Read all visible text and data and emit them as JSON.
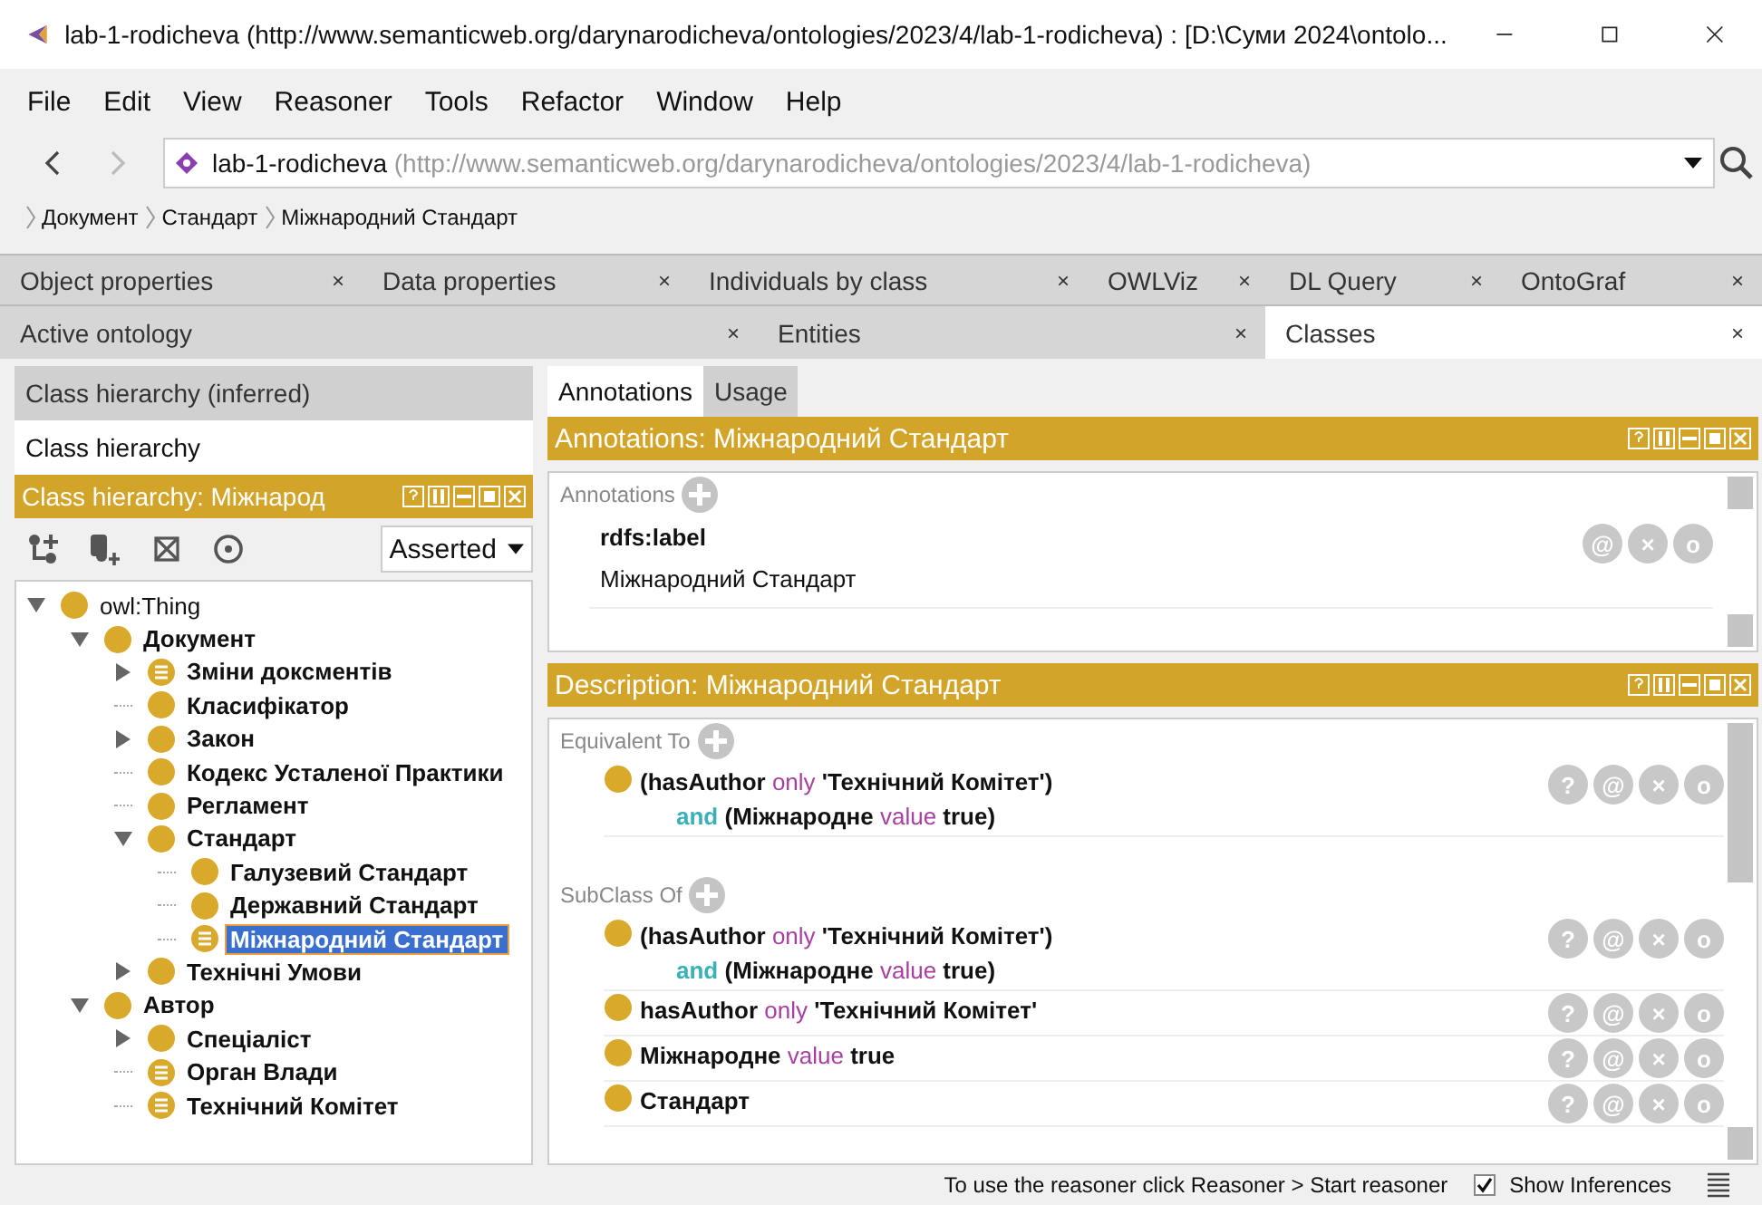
{
  "window": {
    "title": "lab-1-rodicheva (http://www.semanticweb.org/darynarodicheva/ontologies/2023/4/lab-1-rodicheva)  : [D:\\Суми 2024\\ontolo..."
  },
  "menu": [
    "File",
    "Edit",
    "View",
    "Reasoner",
    "Tools",
    "Refactor",
    "Window",
    "Help"
  ],
  "address": {
    "name": "lab-1-rodicheva",
    "iri": "(http://www.semanticweb.org/darynarodicheva/ontologies/2023/4/lab-1-rodicheva)"
  },
  "breadcrumb": [
    "Документ",
    "Стандарт",
    "Міжнародний Стандарт"
  ],
  "tabs_row_1": [
    {
      "label": "Object properties",
      "selected": false
    },
    {
      "label": "Data properties",
      "selected": false
    },
    {
      "label": "Individuals by class",
      "selected": false
    },
    {
      "label": "OWLViz",
      "selected": false
    },
    {
      "label": "DL Query",
      "selected": false
    },
    {
      "label": "OntoGraf",
      "selected": false
    }
  ],
  "tabs_row_2": [
    {
      "label": "Active ontology",
      "selected": false
    },
    {
      "label": "Entities",
      "selected": false
    },
    {
      "label": "Classes",
      "selected": true
    }
  ],
  "close_mark": "×",
  "left": {
    "view_tabs": [
      {
        "label": "Class hierarchy (inferred)",
        "selected": false
      },
      {
        "label": "Class hierarchy",
        "selected": true
      }
    ],
    "header": "Class hierarchy: Міжнарод",
    "mode": "Asserted",
    "tree": [
      {
        "label": "owl:Thing",
        "kind": "primitive",
        "expanded": true,
        "selected": false,
        "children": [
          {
            "label": "Документ",
            "kind": "primitive",
            "expanded": true,
            "selected": false,
            "children": [
              {
                "label": "Зміни доксментів",
                "kind": "defined",
                "expanded": false,
                "selected": false
              },
              {
                "label": "Класифікатор",
                "kind": "primitive",
                "selected": false
              },
              {
                "label": "Закон",
                "kind": "primitive",
                "expanded": false,
                "selected": false
              },
              {
                "label": "Кодекс Усталеної Практики",
                "kind": "primitive",
                "selected": false
              },
              {
                "label": "Регламент",
                "kind": "primitive",
                "selected": false
              },
              {
                "label": "Стандарт",
                "kind": "primitive",
                "expanded": true,
                "selected": false,
                "children": [
                  {
                    "label": "Галузевий Стандарт",
                    "kind": "primitive",
                    "selected": false
                  },
                  {
                    "label": "Державний Стандарт",
                    "kind": "primitive",
                    "selected": false
                  },
                  {
                    "label": "Міжнародний Стандарт",
                    "kind": "defined",
                    "selected": true
                  }
                ]
              },
              {
                "label": "Технічні Умови",
                "kind": "primitive",
                "expanded": false,
                "selected": false
              }
            ]
          },
          {
            "label": "Автор",
            "kind": "primitive",
            "expanded": true,
            "selected": false,
            "children": [
              {
                "label": "Спеціаліст",
                "kind": "primitive",
                "expanded": false,
                "selected": false
              },
              {
                "label": "Орган Влади",
                "kind": "defined",
                "selected": false
              },
              {
                "label": "Технічний Комітет",
                "kind": "defined",
                "selected": false
              }
            ]
          }
        ]
      }
    ]
  },
  "right": {
    "view_tabs": [
      {
        "label": "Annotations",
        "selected": true
      },
      {
        "label": "Usage",
        "selected": false
      }
    ],
    "annotations_header": "Annotations: Міжнародний Стандарт",
    "annotations": {
      "title": "Annotations",
      "items": [
        {
          "property": "rdfs:label",
          "value": "Міжнародний Стандарт",
          "buttons": [
            "@",
            "×",
            "o"
          ]
        }
      ]
    },
    "description_header": "Description: Міжнародний Стандарт",
    "sections": [
      {
        "title": "Equivalent To",
        "items": [
          {
            "buttons": [
              "?",
              "@",
              "×",
              "o"
            ],
            "lines": [
              [
                {
                  "t": "(hasAuthor ",
                  "kind": "name"
                },
                {
                  "t": "only",
                  "kind": "keyword"
                },
                {
                  "t": " 'Технічний Комітет')",
                  "kind": "name"
                }
              ],
              [
                {
                  "t": "and",
                  "kind": "connective"
                },
                {
                  "t": " (Міжнародне ",
                  "kind": "name"
                },
                {
                  "t": "value",
                  "kind": "keyword"
                },
                {
                  "t": " true)",
                  "kind": "name"
                }
              ]
            ]
          }
        ]
      },
      {
        "title": "SubClass Of",
        "items": [
          {
            "buttons": [
              "?",
              "@",
              "×",
              "o"
            ],
            "lines": [
              [
                {
                  "t": "(hasAuthor ",
                  "kind": "name"
                },
                {
                  "t": "only",
                  "kind": "keyword"
                },
                {
                  "t": " 'Технічний Комітет')",
                  "kind": "name"
                }
              ],
              [
                {
                  "t": "and",
                  "kind": "connective"
                },
                {
                  "t": " (Міжнародне ",
                  "kind": "name"
                },
                {
                  "t": "value",
                  "kind": "keyword"
                },
                {
                  "t": " true)",
                  "kind": "name"
                }
              ]
            ]
          },
          {
            "buttons": [
              "?",
              "@",
              "×",
              "o"
            ],
            "lines": [
              [
                {
                  "t": "hasAuthor ",
                  "kind": "name"
                },
                {
                  "t": "only",
                  "kind": "keyword"
                },
                {
                  "t": " 'Технічний Комітет'",
                  "kind": "name"
                }
              ]
            ]
          },
          {
            "buttons": [
              "?",
              "@",
              "×",
              "o"
            ],
            "lines": [
              [
                {
                  "t": "Міжнародне ",
                  "kind": "name"
                },
                {
                  "t": "value",
                  "kind": "keyword"
                },
                {
                  "t": " true",
                  "kind": "name"
                }
              ]
            ]
          },
          {
            "buttons": [
              "?",
              "@",
              "×",
              "o"
            ],
            "lines": [
              [
                {
                  "t": "Стандарт",
                  "kind": "name"
                }
              ]
            ]
          }
        ]
      }
    ]
  },
  "status": {
    "message": "To use the reasoner click Reasoner > Start reasoner",
    "show_inferences": {
      "label": "Show Inferences",
      "checked": true
    }
  }
}
